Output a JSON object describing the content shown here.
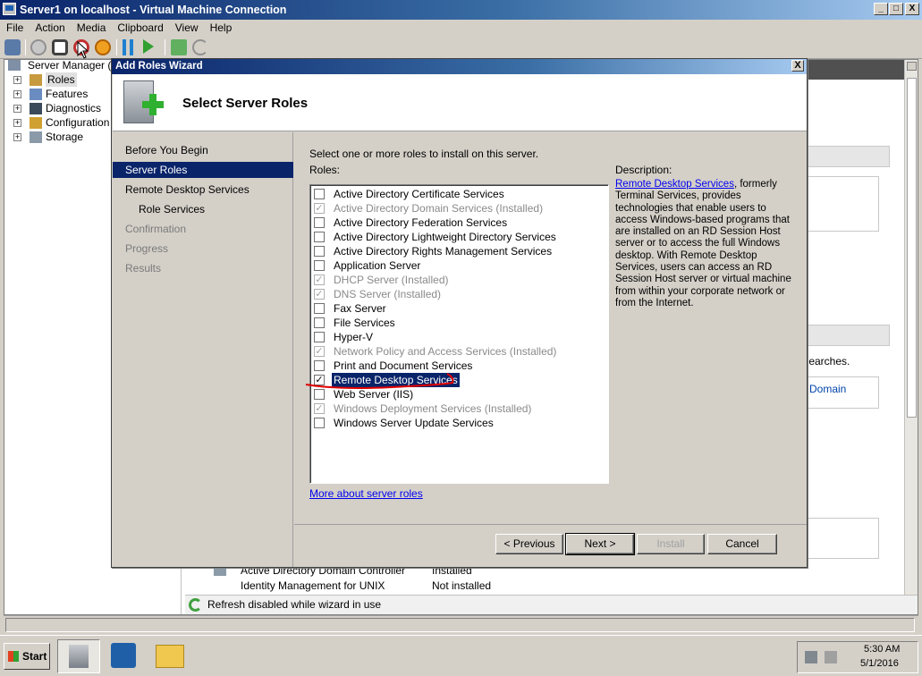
{
  "window": {
    "title": "Server1 on localhost - Virtual Machine Connection",
    "min_glyph": "_",
    "max_glyph": "□",
    "close_glyph": "X"
  },
  "menu": [
    "File",
    "Action",
    "Media",
    "Clipboard",
    "View",
    "Help"
  ],
  "toolbar": {
    "icons": [
      "ctrl-alt-del-icon",
      "start-icon",
      "turn-off-icon",
      "shutdown-icon",
      "save-icon",
      "pause-icon",
      "resume-icon",
      "snapshot-icon",
      "revert-icon"
    ]
  },
  "server_manager": {
    "root_label": "Server Manager (SE",
    "tree": [
      {
        "label": "Roles",
        "icon": "roles-icon"
      },
      {
        "label": "Features",
        "icon": "features-icon"
      },
      {
        "label": "Diagnostics",
        "icon": "diagnostics-icon"
      },
      {
        "label": "Configuration",
        "icon": "configuration-icon"
      },
      {
        "label": "Storage",
        "icon": "storage-icon"
      }
    ],
    "right_fragment_1": "y searches.",
    "right_fragment_2": "Domain",
    "bottom_rows": [
      {
        "name": "Active Directory Domain Controller",
        "status": "Installed"
      },
      {
        "name": "Identity Management for UNIX",
        "status": "Not installed"
      }
    ],
    "status_text": "Refresh disabled while wizard in use"
  },
  "wizard": {
    "title": "Add Roles Wizard",
    "close_glyph": "X",
    "heading": "Select Server Roles",
    "nav": [
      {
        "label": "Before You Begin",
        "state": "normal"
      },
      {
        "label": "Server Roles",
        "state": "active"
      },
      {
        "label": "Remote Desktop Services",
        "state": "normal"
      },
      {
        "label": "Role Services",
        "state": "sub"
      },
      {
        "label": "Confirmation",
        "state": "dim"
      },
      {
        "label": "Progress",
        "state": "dim"
      },
      {
        "label": "Results",
        "state": "dim"
      }
    ],
    "instruction": "Select one or more roles to install on this server.",
    "roles_label": "Roles:",
    "roles": [
      {
        "label": "Active Directory Certificate Services",
        "checked": false,
        "installed": false
      },
      {
        "label": "Active Directory Domain Services  (Installed)",
        "checked": true,
        "installed": true
      },
      {
        "label": "Active Directory Federation Services",
        "checked": false,
        "installed": false
      },
      {
        "label": "Active Directory Lightweight Directory Services",
        "checked": false,
        "installed": false
      },
      {
        "label": "Active Directory Rights Management Services",
        "checked": false,
        "installed": false
      },
      {
        "label": "Application Server",
        "checked": false,
        "installed": false
      },
      {
        "label": "DHCP Server  (Installed)",
        "checked": true,
        "installed": true
      },
      {
        "label": "DNS Server  (Installed)",
        "checked": true,
        "installed": true
      },
      {
        "label": "Fax Server",
        "checked": false,
        "installed": false
      },
      {
        "label": "File Services",
        "checked": false,
        "installed": false
      },
      {
        "label": "Hyper-V",
        "checked": false,
        "installed": false
      },
      {
        "label": "Network Policy and Access Services  (Installed)",
        "checked": true,
        "installed": true
      },
      {
        "label": "Print and Document Services",
        "checked": false,
        "installed": false
      },
      {
        "label": "Remote Desktop Services",
        "checked": true,
        "installed": false,
        "selected": true
      },
      {
        "label": "Web Server (IIS)",
        "checked": false,
        "installed": false
      },
      {
        "label": "Windows Deployment Services  (Installed)",
        "checked": true,
        "installed": true
      },
      {
        "label": "Windows Server Update Services",
        "checked": false,
        "installed": false
      }
    ],
    "more_link": "More about server roles",
    "description_label": "Description:",
    "description_link": "Remote Desktop Services",
    "description_text": ", formerly Terminal Services, provides technologies that enable users to access Windows-based programs that are installed on an RD Session Host server or to access the full Windows desktop. With Remote Desktop Services, users can access an RD Session Host server or virtual machine from within your corporate network or from the Internet.",
    "buttons": {
      "previous": "< Previous",
      "next": "Next >",
      "install": "Install",
      "cancel": "Cancel"
    }
  },
  "taskbar": {
    "start_label": "Start",
    "apps": [
      "server-manager-icon",
      "powershell-icon",
      "explorer-icon"
    ],
    "time": "5:30 AM",
    "date": "5/1/2016"
  },
  "colors": {
    "title_bar": "#0a246a",
    "selection": "#0a246a",
    "annotation": "#e00000",
    "link": "#0000ee"
  }
}
